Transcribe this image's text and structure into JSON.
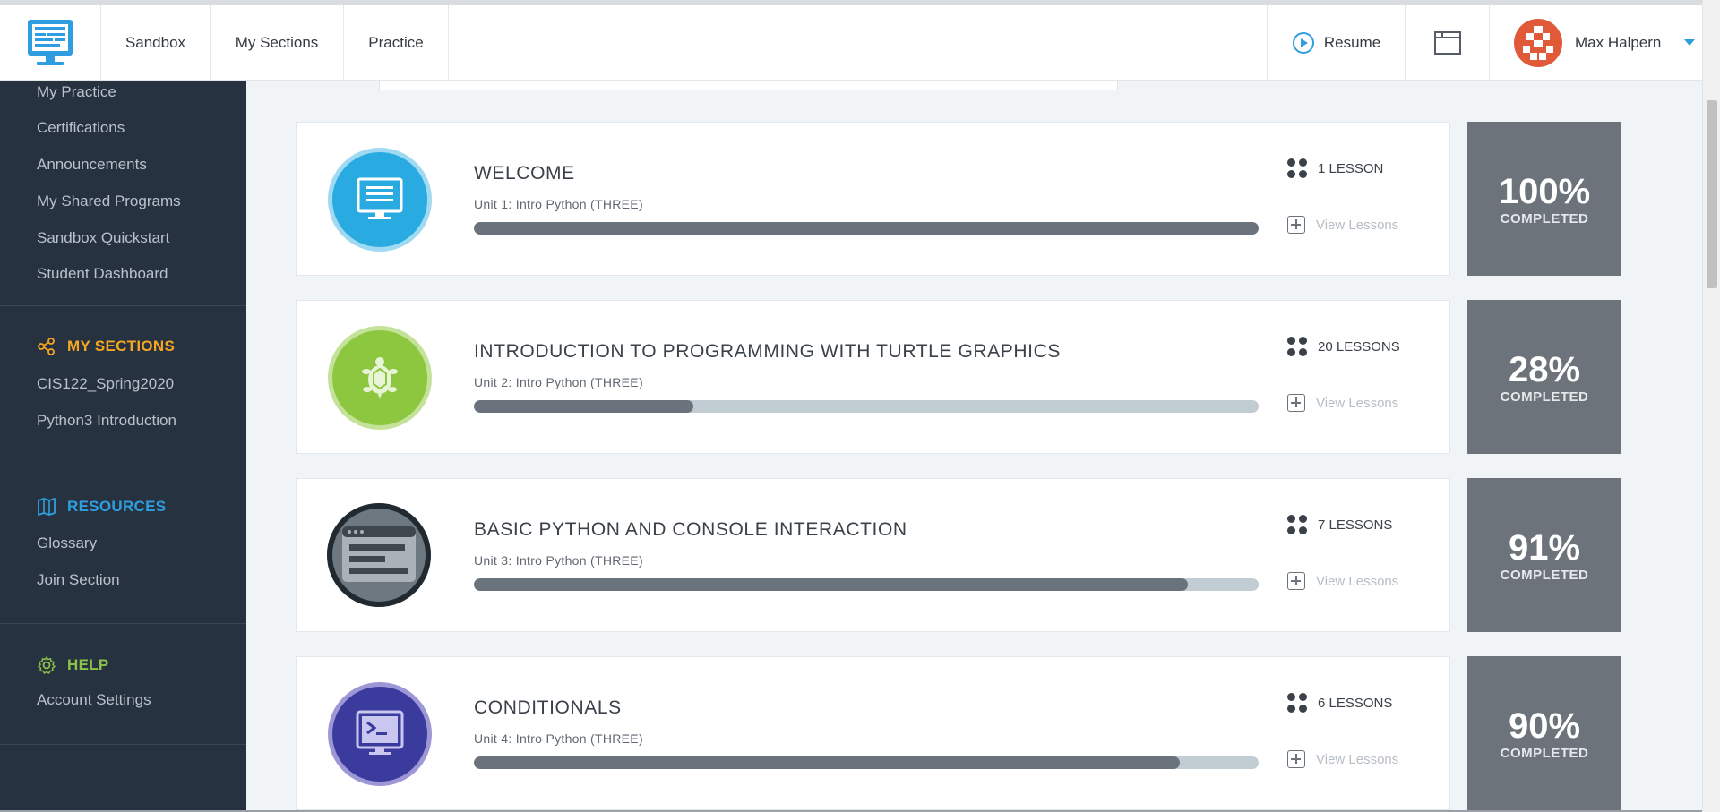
{
  "topbar": {
    "nav": [
      "Sandbox",
      "My Sections",
      "Practice"
    ],
    "resume_label": "Resume",
    "user_name": "Max Halpern",
    "brand_color": "#2f9ee0"
  },
  "sidebar": {
    "links_top": [
      "My Practice",
      "Certifications",
      "Announcements",
      "My Shared Programs",
      "Sandbox Quickstart",
      "Student Dashboard"
    ],
    "sections_heading": "MY SECTIONS",
    "sections": [
      "CIS122_Spring2020",
      "Python3 Introduction"
    ],
    "resources_heading": "RESOURCES",
    "resources": [
      "Glossary",
      "Join Section"
    ],
    "help_heading": "HELP",
    "help": [
      "Account Settings"
    ]
  },
  "units": [
    {
      "title": "WELCOME",
      "subtitle": "Unit 1: Intro Python (THREE)",
      "lessons": "1 LESSON",
      "view_label": "View Lessons",
      "percent_text": "100%",
      "completed_label": "COMPLETED",
      "progress": 1.0,
      "icon": "monitor-icon",
      "icon_color": "#29abe2"
    },
    {
      "title": "INTRODUCTION TO PROGRAMMING WITH TURTLE GRAPHICS",
      "subtitle": "Unit 2: Intro Python (THREE)",
      "lessons": "20 LESSONS",
      "view_label": "View Lessons",
      "percent_text": "28%",
      "completed_label": "COMPLETED",
      "progress": 0.28,
      "icon": "turtle-icon",
      "icon_color": "#8dc63f"
    },
    {
      "title": "BASIC PYTHON AND CONSOLE INTERACTION",
      "subtitle": "Unit 3: Intro Python (THREE)",
      "lessons": "7 LESSONS",
      "view_label": "View Lessons",
      "percent_text": "91%",
      "completed_label": "COMPLETED",
      "progress": 0.91,
      "icon": "console-window-icon",
      "icon_color": "#6d7880"
    },
    {
      "title": "CONDITIONALS",
      "subtitle": "Unit 4: Intro Python (THREE)",
      "lessons": "6 LESSONS",
      "view_label": "View Lessons",
      "percent_text": "90%",
      "completed_label": "COMPLETED",
      "progress": 0.9,
      "icon": "terminal-icon",
      "icon_color": "#3b3b9e"
    }
  ]
}
